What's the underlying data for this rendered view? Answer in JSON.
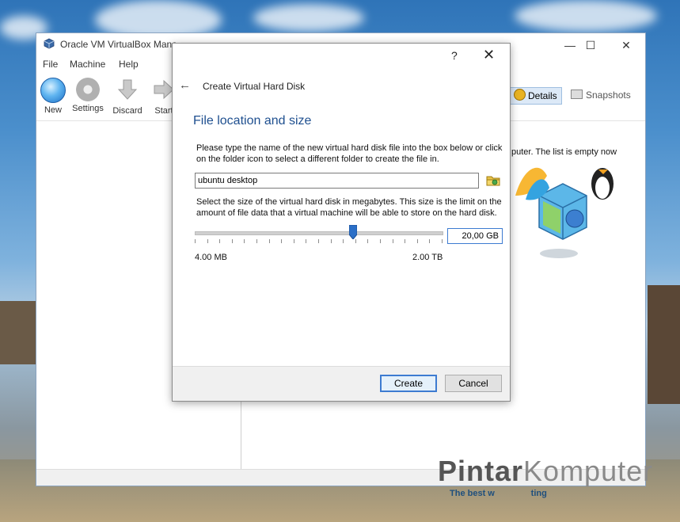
{
  "window": {
    "title": "Oracle VM VirtualBox Mana",
    "minimize": "—",
    "maximize": "☐",
    "close": "✕"
  },
  "menu": [
    "File",
    "Machine",
    "Help"
  ],
  "toolbar": {
    "new": "New",
    "settings": "Settings",
    "discard": "Discard",
    "start": "Start"
  },
  "tabs": {
    "details": "Details",
    "snapshots": "Snapshots"
  },
  "welcome_text": "puter. The list is empty now",
  "dialog": {
    "help": "?",
    "close": "✕",
    "back": "←",
    "title": "Create Virtual Hard Disk",
    "heading": "File location and size",
    "file_instructions": "Please type the name of the new virtual hard disk file into the box below or click on the folder icon to select a different folder to create the file in.",
    "file_name": "ubuntu desktop",
    "size_instructions": "Select the size of the virtual hard disk in megabytes. This size is the limit on the amount of file data that a virtual machine will be able to store on the hard disk.",
    "size_value": "20,00 GB",
    "range_min": "4.00 MB",
    "range_max": "2.00 TB",
    "slider_position": 0.64,
    "create_label": "Create",
    "cancel_label": "Cancel"
  },
  "watermark": {
    "brand_a": "Pintar",
    "brand_b": "Komputer",
    "tagline": "The best w               ting"
  },
  "colors": {
    "heading": "#1e4f8f",
    "accent": "#3d7bd1"
  }
}
